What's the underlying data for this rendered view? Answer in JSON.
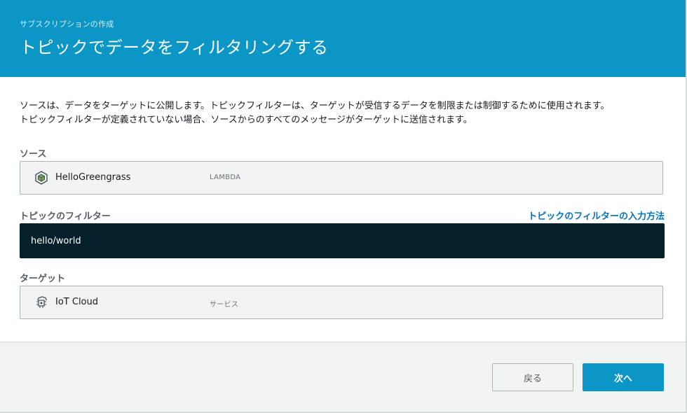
{
  "header": {
    "breadcrumb": "サブスクリプションの作成",
    "title": "トピックでデータをフィルタリングする"
  },
  "description": {
    "line1": "ソースは、データをターゲットに公開します。トピックフィルターは、ターゲットが受信するデータを制限または制御するために使用されます。",
    "line2": "トピックフィルターが定義されていない場合、ソースからのすべてのメッセージがターゲットに送信されます。"
  },
  "source": {
    "label": "ソース",
    "name": "HelloGreengrass",
    "type": "LAMBDA",
    "icon": "lambda-cube-icon"
  },
  "topic_filter": {
    "label": "トピックのフィルター",
    "value": "hello/world",
    "help_link": "トピックのフィルターの入力方法"
  },
  "target": {
    "label": "ターゲット",
    "name": "IoT Cloud",
    "type": "サービス",
    "icon": "iot-cloud-chip-icon"
  },
  "buttons": {
    "back": "戻る",
    "next": "次へ"
  },
  "colors": {
    "header_bg": "#0b96c6",
    "primary_button": "#0b96c6",
    "input_bg": "#05202b",
    "link": "#0073bb"
  }
}
